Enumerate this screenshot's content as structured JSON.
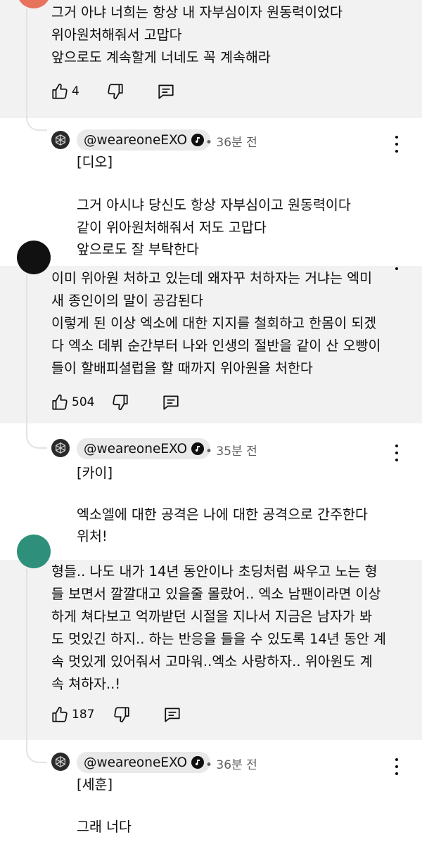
{
  "comments": [
    {
      "lines": [
        "그거 아냐 너희는 항상 내 자부심이자 원동력이었다",
        "위아원처해줘서 고맙다",
        "앞으로도 계속할게 너네도 꼭 계속해라"
      ],
      "likes": "4"
    },
    {
      "lines": [
        "이미 위아원 처하고 있는데 왜자꾸 처하자는 거냐는 엑미",
        "새 종인이의 말이 공감된다",
        "이렇게 된 이상 엑소에 대한 지지를 철회하고 한몸이 되겠",
        "다 엑소 데뷔 순간부터 나와 인생의 절반을 같이 산 오빵이",
        "들이 할배피셜럽을 할 때까지 위아원을 처한다"
      ],
      "likes": "504"
    },
    {
      "lines": [
        "형들.. 나도 내가 14년 동안이나 초딩처럼 싸우고 노는 형",
        "들 보면서 깔깔대고 있을줄 몰랐어.. 엑소 남팬이라면 이상",
        "하게 쳐다보고 억까받던 시절을 지나서 지금은 남자가 봐",
        "도 멋있긴 하지.. 하는 반응을 들을 수 있도록 14년 동안 계",
        "속 멋있게 있어줘서 고마워..엑소 사랑하자.. 위아원도 계",
        "속 쳐하자..!"
      ],
      "likes": "187"
    }
  ],
  "replies": [
    {
      "handle": "@weareoneEXO",
      "time": "• 36분 전",
      "member": "[디오]",
      "lines": [
        "그거 아시냐 당신도 항상 자부심이고 원동력이다",
        "같이 위아원처해줘서 저도 고맙다",
        "앞으로도 잘 부탁한다"
      ]
    },
    {
      "handle": "@weareoneEXO",
      "time": "• 35분 전",
      "member": "[카이]",
      "lines": [
        "엑소엘에 대한 공격은 나에 대한 공격으로 간주한다",
        "위처!"
      ]
    },
    {
      "handle": "@weareoneEXO",
      "time": "• 36분 전",
      "member": "[세훈]",
      "lines": [
        "그래 너다"
      ]
    }
  ],
  "icons": {
    "like": "thumbs-up-icon",
    "dislike": "thumbs-down-icon",
    "reply": "comment-reply-icon",
    "more": "more-vertical-icon",
    "verified": "music-note-verified-icon"
  },
  "colors": {
    "comment_bg": "#f2f2f2",
    "reply_bg": "#ffffff",
    "meta_text": "#606060",
    "avatar_1": "#e8735d",
    "avatar_2": "#111111",
    "avatar_3": "#2e8f7a"
  }
}
